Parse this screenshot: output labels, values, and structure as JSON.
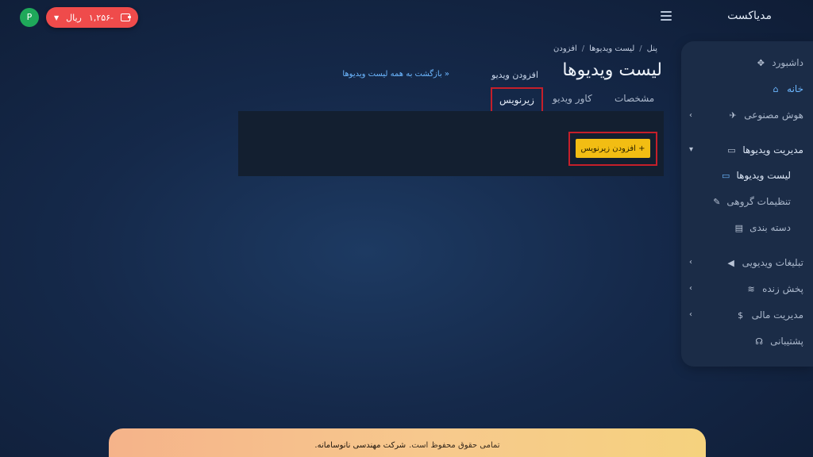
{
  "header": {
    "brand": "مدیاکست",
    "wallet": {
      "amount": "-۱,۲۵۶",
      "currency": "ریال"
    },
    "avatar_letter": "P"
  },
  "sidebar": {
    "items": [
      {
        "label": "داشبورد",
        "icon": "puzzle-icon"
      },
      {
        "label": "خانه",
        "icon": "home-icon",
        "active": true
      },
      {
        "label": "هوش مصنوعی",
        "icon": "rocket-icon",
        "expandable": true
      },
      {
        "label": "مدیریت ویدیوها",
        "icon": "video-icon",
        "expandable": true,
        "expanded": true
      },
      {
        "label": "تبلیغات ویدیویی",
        "icon": "megaphone-icon",
        "expandable": true
      },
      {
        "label": "پخش زنده",
        "icon": "wifi-icon",
        "expandable": true
      },
      {
        "label": "مدیریت مالی",
        "icon": "dollar-icon",
        "expandable": true
      },
      {
        "label": "پشتیبانی",
        "icon": "headset-icon"
      }
    ],
    "sub_items": [
      {
        "label": "لیست ویدیوها",
        "icon": "video-icon",
        "active": true
      },
      {
        "label": "تنظیمات گروهی",
        "icon": "wrench-icon"
      },
      {
        "label": "دسته بندی",
        "icon": "keyboard-icon"
      }
    ]
  },
  "breadcrumb": [
    "پنل",
    "لیست ویدیوها",
    "افزودن"
  ],
  "page": {
    "title": "لیست ویدیوها",
    "subtitle": "افزودن ویدیو",
    "back_link": "« بازگشت به همه لیست ویدیوها"
  },
  "tabs": [
    "مشخصات",
    "کاور ویدیو",
    "زیرنویس"
  ],
  "active_tab": "زیرنویس",
  "add_subtitle_button": "+ افزودن زیرنویس",
  "footer": {
    "text": "تمامی حقوق محفوظ است.",
    "company": "شرکت مهندسی نانوسامانه."
  },
  "colors": {
    "accent": "#6cb7ff",
    "wallet": "#ef4b4b",
    "button": "#f2bd13",
    "highlight": "#c51f2a"
  }
}
